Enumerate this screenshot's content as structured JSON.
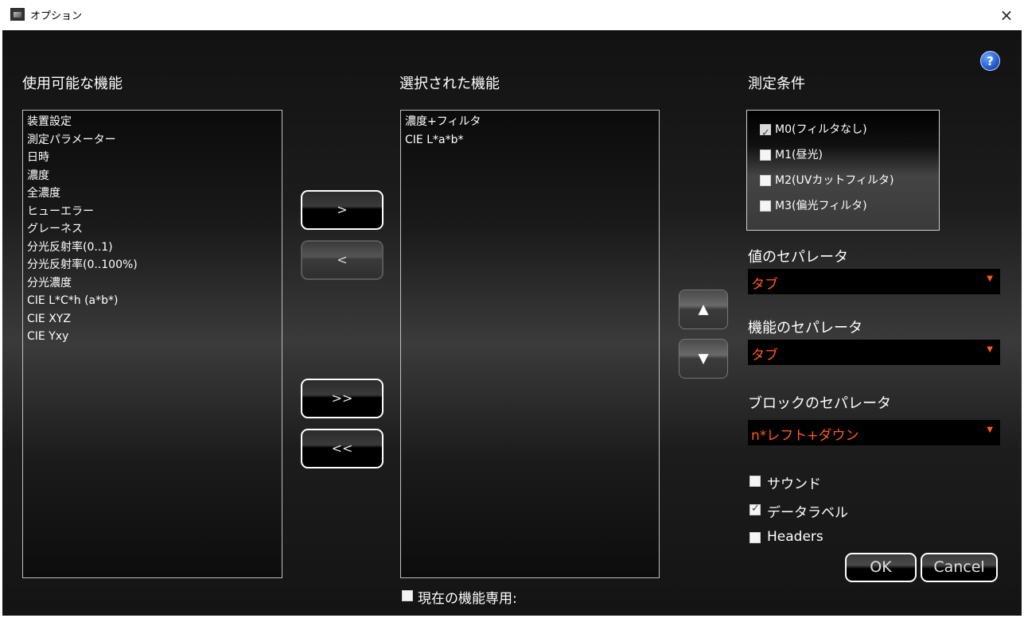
{
  "window": {
    "title": "オプション",
    "close": "×"
  },
  "help": {
    "symbol": "?"
  },
  "available": {
    "heading": "使用可能な機能",
    "items": [
      "装置設定",
      "測定パラメーター",
      "日時",
      "濃度",
      "全濃度",
      "ヒューエラー",
      "グレーネス",
      "分光反射率(0..1)",
      "分光反射率(0..100%)",
      "分光濃度",
      "CIE L*C*h (a*b*)",
      "CIE XYZ",
      "CIE Yxy"
    ]
  },
  "selected": {
    "heading": "選択された機能",
    "items": [
      "濃度+フィルタ",
      "CIE L*a*b*"
    ]
  },
  "transfer": {
    "add": ">",
    "remove": "<",
    "add_all": ">>",
    "remove_all": "<<"
  },
  "order": {
    "up": "▲",
    "down": "▼"
  },
  "conditions": {
    "heading": "測定条件",
    "items": [
      {
        "label": "M0(フィルタなし)",
        "checked": true
      },
      {
        "label": "M1(昼光)",
        "checked": false
      },
      {
        "label": "M2(UVカットフィルタ)",
        "checked": false
      },
      {
        "label": "M3(偏光フィルタ)",
        "checked": false
      }
    ]
  },
  "separators": {
    "value": {
      "label": "値のセパレータ",
      "selected": "タブ"
    },
    "feature": {
      "label": "機能のセパレータ",
      "selected": "タブ"
    },
    "block": {
      "label": "ブロックのセパレータ",
      "selected": "n*レフト+ダウン"
    }
  },
  "options": {
    "sound": {
      "label": "サウンド",
      "checked": false
    },
    "data_label": {
      "label": "データラベル",
      "checked": true
    },
    "headers": {
      "label": "Headers",
      "checked": false
    }
  },
  "current_only": {
    "label": "現在の機能専用:",
    "checked": false
  },
  "buttons": {
    "ok": "OK",
    "cancel": "Cancel"
  },
  "colors": {
    "accent": "#ff5a1a",
    "background": "#1c1c1c"
  }
}
